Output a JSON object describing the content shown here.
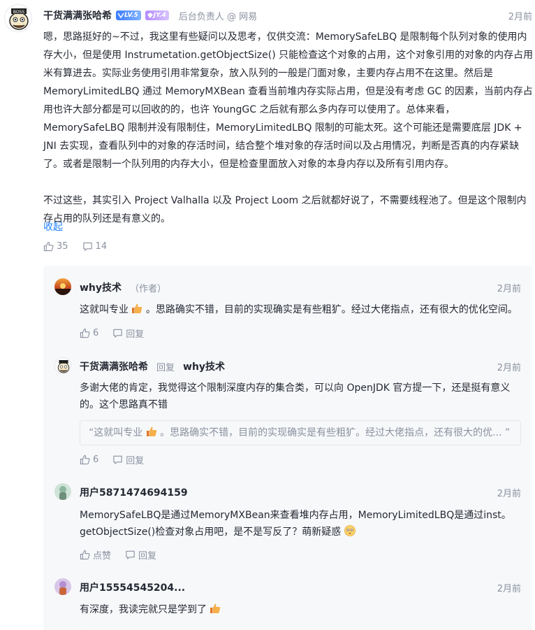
{
  "main": {
    "author": "干货满满张哈希",
    "level": "LV.5",
    "jy": "JY.4",
    "job": "后台负责人 @ 网易",
    "time": "2月前",
    "paragraphs": [
      "嗯，思路挺好的~不过，我这里有些疑问以及思考，仅供交流：MemorySafeLBQ 是限制每个队列对象的使用内存大小，但是使用 Instrumetation.getObjectSize() 只能检查这个对象的占用，这个对象引用的对象的内存占用米有算进去。实际业务使用引用非常复杂，放入队列的一般是门面对象，主要内存占用不在这里。然后是 MemoryLimitedLBQ 通过 MemoryMXBean 查看当前堆内存实际占用，但是没有考虑 GC 的因素，当前内存占用也许大部分都是可以回收的的，也许 YoungGC 之后就有那么多内存可以使用了。总体来看，MemorySafeLBQ 限制并没有限制住，MemoryLimitedLBQ 限制的可能太死。这个可能还是需要底层 JDK + JNI 去实现，查看队列中的对象的存活时间，结合整个堆对象的存活时间以及占用情况，判断是否真的内存紧缺了。或者是限制一个队列用的内存大小，但是检查里面放入对象的本身内存以及所有引用内存。",
      "不过这些，其实引入 Project Valhalla 以及 Project Loom 之后就都好说了，不需要线程池了。但是这个限制内存占用的队列还是有意义的。"
    ],
    "collapse_label": "收起",
    "likes": "35",
    "comments": "14"
  },
  "replies": [
    {
      "author": "why技术",
      "tag": "（作者）",
      "time": "2月前",
      "text_before": "这就叫专业",
      "text_after": "。思路确实不错，目前的实现确实是有些粗犷。经过大佬指点，还有很大的优化空间。",
      "likes": "6",
      "reply_label": "回复"
    },
    {
      "author": "干货满满张哈希",
      "reply_word": "回复",
      "target": "why技术",
      "time": "2月前",
      "text": "多谢大佬的肯定，我觉得这个限制深度内存的集合类，可以向 OpenJDK 官方提一下，还是挺有意义的。这个思路真不错",
      "quote_before": "“这就叫专业",
      "quote_after": "。思路确实不错，目前的实现确实是有些粗犷。经过大佬指点，还有很大的优...   ”",
      "likes": "6",
      "reply_label": "回复"
    },
    {
      "author": "用户5871474694159",
      "time": "2月前",
      "text": "MemorySafeLBQ是通过MemoryMXBean来查看堆内存占用，MemoryLimitedLBQ是通过inst。getObjectSize()检查对象占用吧，是不是写反了？萌新疑惑",
      "likes": "点赞",
      "reply_label": "回复"
    },
    {
      "author": "用户15554545204...",
      "time": "2月前",
      "text": "有深度，我读完就只是学到了",
      "likes": "点赞",
      "reply_label": "回复"
    }
  ],
  "colors": {
    "link": "#1e80ff",
    "muted": "#8a919f",
    "text": "#252933",
    "reply_bg": "#f7f8fa"
  }
}
